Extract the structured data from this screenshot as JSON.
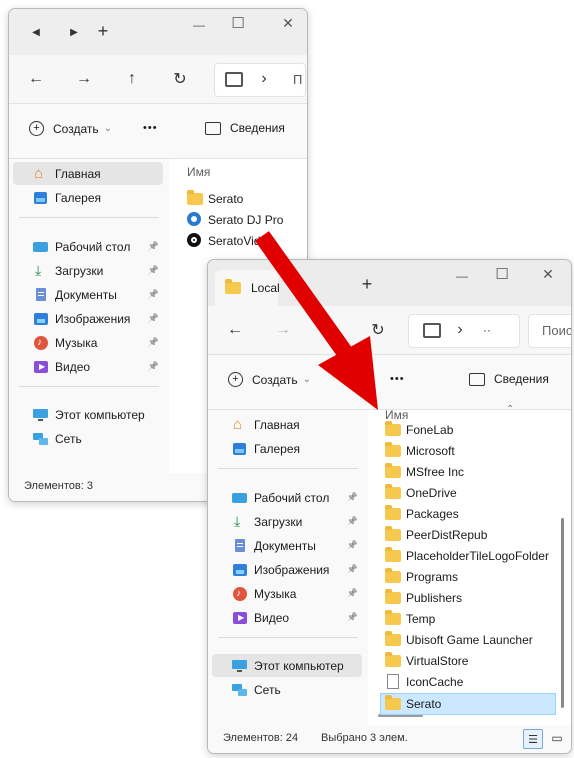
{
  "win1": {
    "back_icon": "◀",
    "forward_icon": "▶",
    "new_tab": "+",
    "title_minimize": "—",
    "title_maximize": "☐",
    "title_close": "✕",
    "nav": {
      "back": "←",
      "forward": "→",
      "up": "↑",
      "refresh": "↻",
      "chevron": "›",
      "address_stub": "П"
    },
    "cmd": {
      "create": "Создать",
      "create_caret": "⌄",
      "more": "•••",
      "details": "Сведения"
    },
    "sidebar": {
      "items1": [
        {
          "label": "Главная",
          "icon": "home-icon"
        },
        {
          "label": "Галерея",
          "icon": "gallery-icon"
        }
      ],
      "items2": [
        {
          "label": "Рабочий стол",
          "icon": "desktop-icon"
        },
        {
          "label": "Загрузки",
          "icon": "downloads-icon"
        },
        {
          "label": "Документы",
          "icon": "documents-icon"
        },
        {
          "label": "Изображения",
          "icon": "pictures-icon"
        },
        {
          "label": "Музыка",
          "icon": "music-icon"
        },
        {
          "label": "Видео",
          "icon": "videos-icon"
        }
      ],
      "items3": [
        {
          "label": "Этот компьютер",
          "icon": "this-pc-icon"
        },
        {
          "label": "Сеть",
          "icon": "network-icon"
        }
      ]
    },
    "column_name": "Имя",
    "files": [
      {
        "name": "Serato",
        "icon": "folder-icon"
      },
      {
        "name": "Serato DJ Pro",
        "icon": "serato-dj-pro-icon"
      },
      {
        "name": "SeratoVideo",
        "icon": "serato-video-icon"
      }
    ],
    "status": {
      "items": "Элементов: 3"
    }
  },
  "win2": {
    "tab_title": "Local",
    "new_tab": "+",
    "title_minimize": "—",
    "title_maximize": "☐",
    "title_close": "✕",
    "nav": {
      "back": "←",
      "forward": "→",
      "up": "↑",
      "refresh": "↻",
      "chevron": "›",
      "more": "··",
      "search_placeholder": "Поис"
    },
    "cmd": {
      "create": "Создать",
      "create_caret": "⌄",
      "more": "•••",
      "details": "Сведения"
    },
    "sidebar": {
      "items1": [
        {
          "label": "Главная",
          "icon": "home-icon"
        },
        {
          "label": "Галерея",
          "icon": "gallery-icon"
        }
      ],
      "items2": [
        {
          "label": "Рабочий стол",
          "icon": "desktop-icon"
        },
        {
          "label": "Загрузки",
          "icon": "downloads-icon"
        },
        {
          "label": "Документы",
          "icon": "documents-icon"
        },
        {
          "label": "Изображения",
          "icon": "pictures-icon"
        },
        {
          "label": "Музыка",
          "icon": "music-icon"
        },
        {
          "label": "Видео",
          "icon": "videos-icon"
        }
      ],
      "items3": [
        {
          "label": "Этот компьютер",
          "icon": "this-pc-icon"
        },
        {
          "label": "Сеть",
          "icon": "network-icon"
        }
      ]
    },
    "column_name": "Имя",
    "sort_caret": "⌃",
    "files": [
      {
        "name": "FoneLab",
        "icon": "folder-icon"
      },
      {
        "name": "Microsoft",
        "icon": "folder-icon"
      },
      {
        "name": "MSfree Inc",
        "icon": "folder-icon"
      },
      {
        "name": "OneDrive",
        "icon": "folder-icon"
      },
      {
        "name": "Packages",
        "icon": "folder-icon"
      },
      {
        "name": "PeerDistRepub",
        "icon": "folder-icon"
      },
      {
        "name": "PlaceholderTileLogoFolder",
        "icon": "folder-icon"
      },
      {
        "name": "Programs",
        "icon": "folder-icon"
      },
      {
        "name": "Publishers",
        "icon": "folder-icon"
      },
      {
        "name": "Temp",
        "icon": "folder-icon"
      },
      {
        "name": "Ubisoft Game Launcher",
        "icon": "folder-icon"
      },
      {
        "name": "VirtualStore",
        "icon": "folder-icon"
      },
      {
        "name": "IconCache",
        "icon": "file-icon"
      },
      {
        "name": "Serato",
        "icon": "folder-icon",
        "selected": true
      }
    ],
    "status": {
      "items": "Элементов: 24",
      "selected": "Выбрано 3 элем."
    }
  },
  "arrow": {
    "color": "#e00000"
  }
}
